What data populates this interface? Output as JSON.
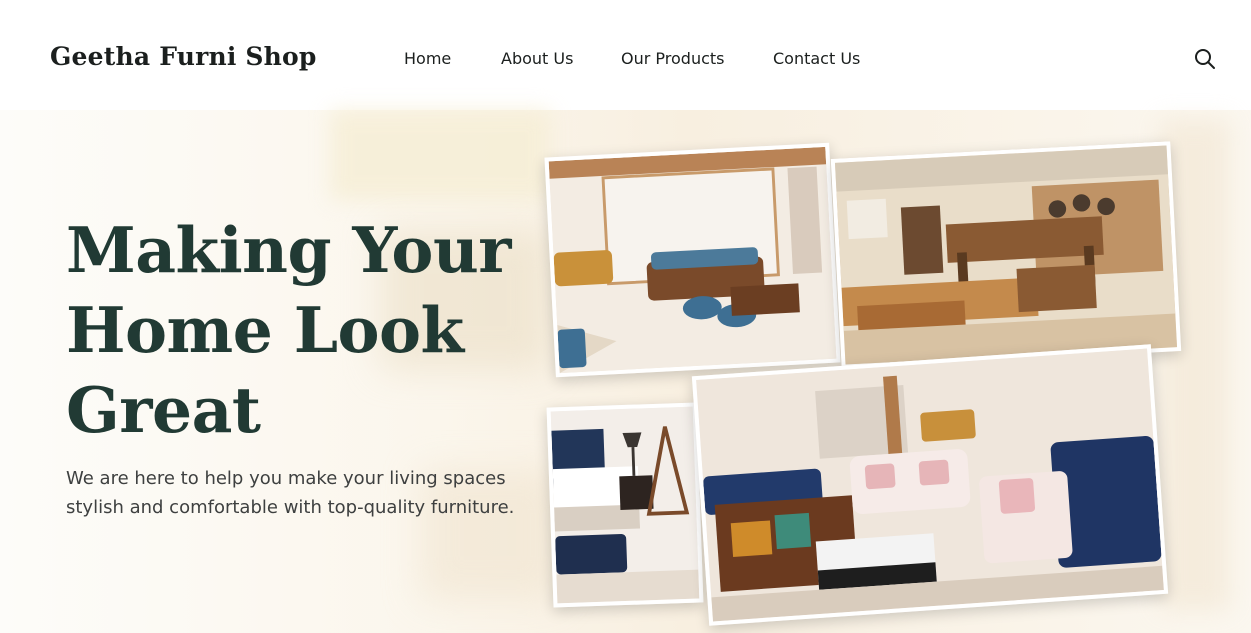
{
  "brand": {
    "name": "Geetha Furni Shop"
  },
  "nav": {
    "items": [
      {
        "label": "Home"
      },
      {
        "label": "About Us"
      },
      {
        "label": "Our Products"
      },
      {
        "label": "Contact Us"
      }
    ],
    "search_icon": "search-icon"
  },
  "hero": {
    "headline_lines": [
      "Making Your",
      "Home Look",
      "Great"
    ],
    "subtext": "We are here to help you make your living spaces stylish and comfortable with top-quality furniture."
  },
  "colors": {
    "headline": "#213a34",
    "brand_text": "#1b1f1e",
    "body_text": "#3e4040",
    "hero_bg": "#fbf6ec"
  }
}
